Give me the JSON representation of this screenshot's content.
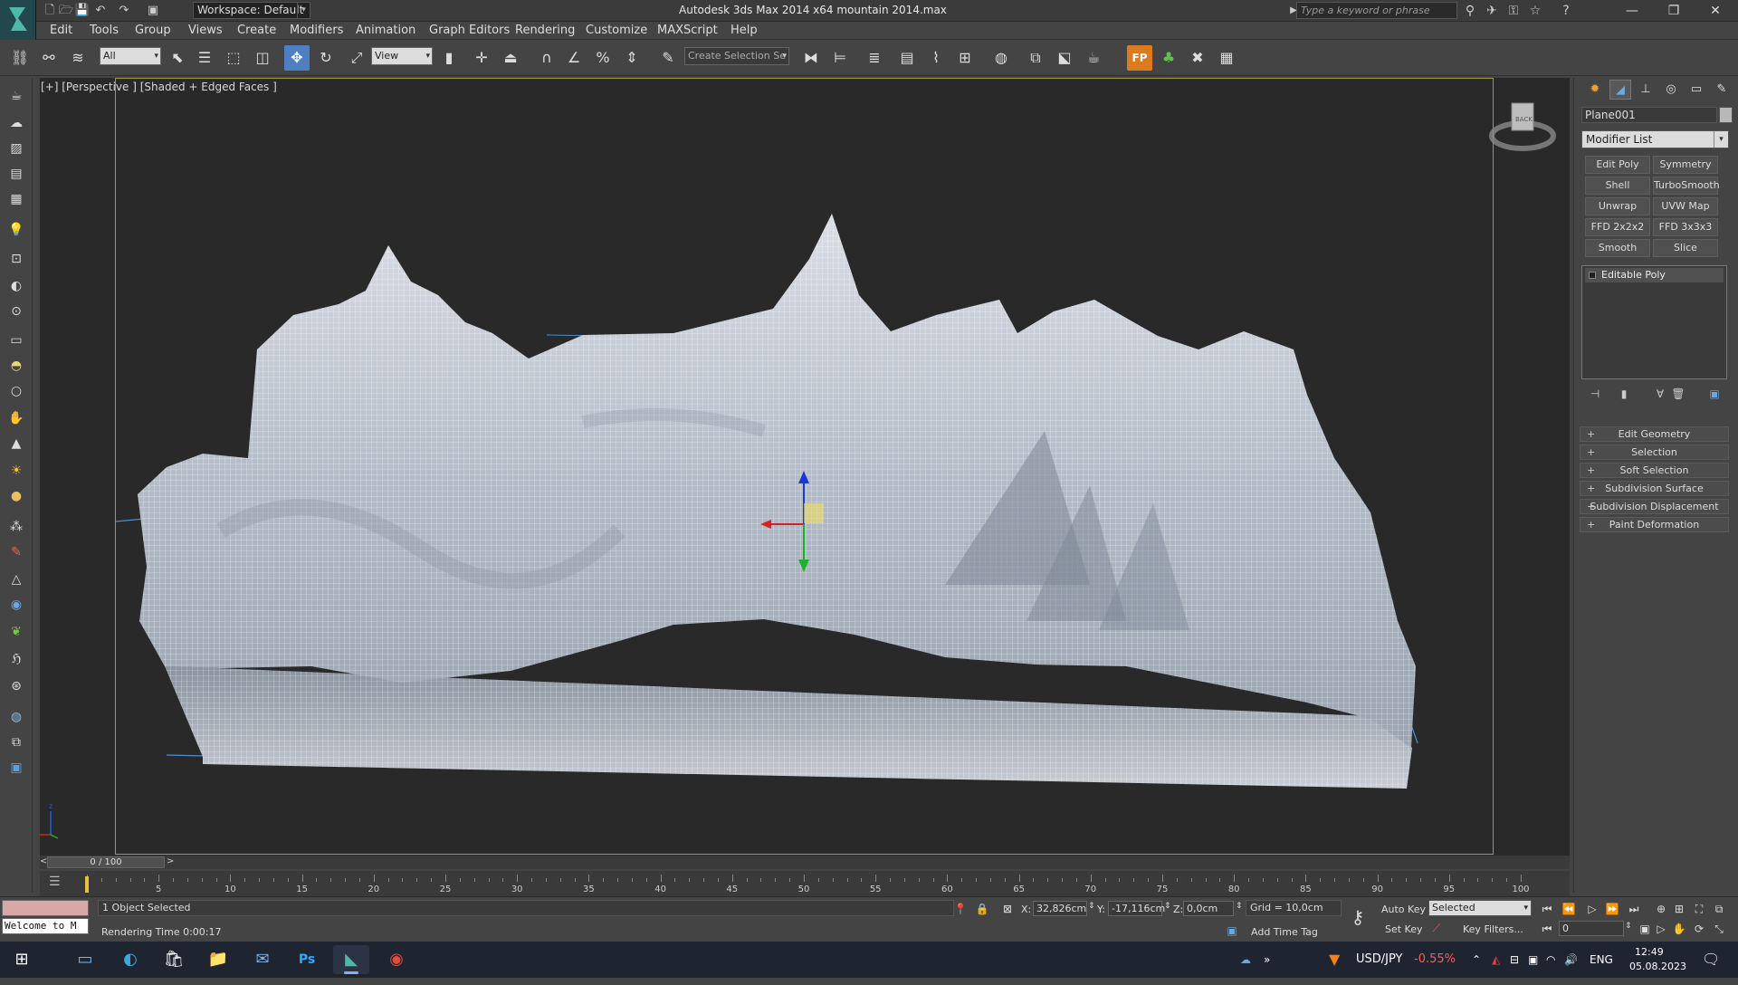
{
  "app": {
    "title": "Autodesk 3ds Max  2014 x64     mountain  2014.max",
    "workspace": "Workspace: Default",
    "search_placeholder": "Type a keyword or phrase"
  },
  "menu": [
    "Edit",
    "Tools",
    "Group",
    "Views",
    "Create",
    "Modifiers",
    "Animation",
    "Graph Editors",
    "Rendering",
    "Customize",
    "MAXScript",
    "Help"
  ],
  "toolbar": {
    "selection_filter": "All",
    "ref_coord": "View",
    "named_selection": "Create Selection Se"
  },
  "viewport": {
    "label": "[+] [Perspective ] [Shaded + Edged Faces ]",
    "viewcube_label": "BACK"
  },
  "command_panel": {
    "object_name": "Plane001",
    "modifier_list": "Modifier List",
    "modifier_buttons": [
      "Edit Poly",
      "Symmetry",
      "Shell",
      "TurboSmooth",
      "Unwrap UVW",
      "UVW Map",
      "FFD 2x2x2",
      "FFD 3x3x3",
      "Smooth",
      "Slice"
    ],
    "stack_item": "Editable Poly",
    "rollouts": [
      "Edit Geometry",
      "Selection",
      "Soft Selection",
      "Subdivision Surface",
      "Subdivision Displacement",
      "Paint Deformation"
    ]
  },
  "timeline": {
    "frame": "0 / 100",
    "ticks": [
      "0",
      "5",
      "10",
      "15",
      "20",
      "25",
      "30",
      "35",
      "40",
      "45",
      "50",
      "55",
      "60",
      "65",
      "70",
      "75",
      "80",
      "85",
      "90",
      "95",
      "100"
    ]
  },
  "status": {
    "script_listener": "Welcome to M",
    "selected": "1 Object Selected",
    "render_time": "Rendering Time  0:00:17",
    "x_label": "X:",
    "x": "32,826cm",
    "y_label": "Y:",
    "y": "-17,116cm",
    "z_label": "Z:",
    "z": "0,0cm",
    "grid": "Grid = 10,0cm",
    "add_time_tag": "Add Time Tag",
    "auto_key": "Auto Key",
    "auto_key_mode": "Selected",
    "set_key": "Set Key",
    "key_filters": "Key Filters...",
    "current_frame": "0"
  },
  "taskbar": {
    "currency_pair": "USD/JPY",
    "currency_change": "-0.55%",
    "lang": "ENG",
    "time": "12:49",
    "date": "05.08.2023",
    "colors": {
      "negative": "#ff5a5a",
      "accent": "#4d7fc2"
    }
  }
}
